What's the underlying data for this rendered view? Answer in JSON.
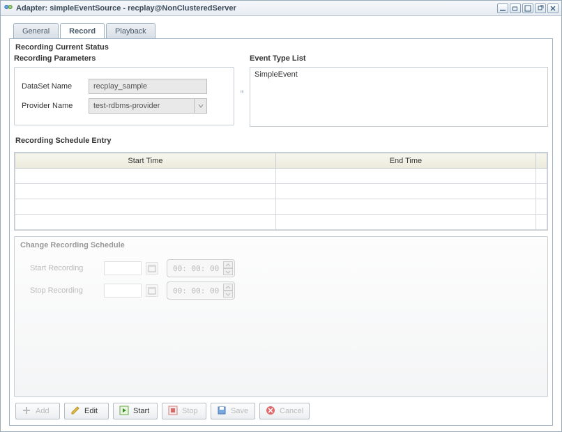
{
  "window": {
    "title": "Adapter: simpleEventSource - recplay@NonClusteredServer"
  },
  "tabs": {
    "general": "General",
    "record": "Record",
    "playback": "Playback"
  },
  "status_section": "Recording Current Status",
  "params_section": "Recording Parameters",
  "event_section": "Event Type List",
  "form": {
    "dataset_label": "DataSet Name",
    "dataset_value": "recplay_sample",
    "provider_label": "Provider Name",
    "provider_value": "test-rdbms-provider"
  },
  "event_list": {
    "item0": "SimpleEvent"
  },
  "schedule": {
    "title": "Recording Schedule Entry",
    "col_start": "Start Time",
    "col_end": "End Time"
  },
  "change": {
    "title": "Change Recording Schedule",
    "start_label": "Start Recording",
    "stop_label": "Stop Recording",
    "time_zero": "00: 00: 00"
  },
  "buttons": {
    "add": "Add",
    "edit": "Edit",
    "start": "Start",
    "stop": "Stop",
    "save": "Save",
    "cancel": "Cancel"
  }
}
